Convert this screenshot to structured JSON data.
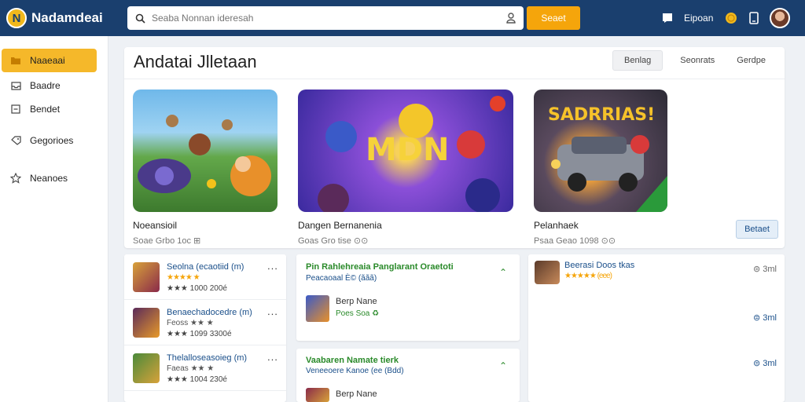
{
  "header": {
    "logo_mark": "N",
    "logo_text": "Nadamdeai",
    "search_placeholder": "Seaba Nonnan ideresah",
    "search_button": "Seaet",
    "user_label": "Eipoan"
  },
  "sidebar": {
    "items": [
      {
        "label": "Naaeaai",
        "icon": "folder-icon",
        "active": true
      },
      {
        "label": "Baadre",
        "icon": "inbox-icon",
        "active": false
      },
      {
        "label": "Bendet",
        "icon": "minus-box-icon",
        "active": false
      },
      {
        "label": "Gegorioes",
        "icon": "tag-icon",
        "active": false
      },
      {
        "label": "Neanoes",
        "icon": "star-outline-icon",
        "active": false
      }
    ]
  },
  "featured": {
    "title": "Andatai Jlletaan",
    "tabs": [
      "Benlag",
      "Seonrats",
      "Gerdpe"
    ],
    "cards": [
      {
        "name": "Noeansioil",
        "meta": "Soae Grbo 1oc ⊞"
      },
      {
        "name": "Dangen Bernanenia",
        "meta": "Goas Gro tise ⊙⊙"
      },
      {
        "name": "Pelanhaek",
        "meta": "Psaa Geao 1098 ⊙⊙"
      }
    ],
    "button": "Betaet",
    "art_text": {
      "card2": "MDN",
      "card3": "SADRRIAS!"
    }
  },
  "left_list": [
    {
      "title": "Seolna (ecaotiid (m)",
      "sub": "★★★★ ★",
      "meta": "★★★ 1000 200é"
    },
    {
      "title": "Benaechadocedre (m)",
      "sub": "Feoss ★★ ★",
      "meta": "★★★ 1099 3300é"
    },
    {
      "title": "Thelalloseasoieg (m)",
      "sub": "Faeas ★★ ★",
      "meta": "★★★ 1004 230é"
    }
  ],
  "mid_panel_1": {
    "title": "Pin Rahlehreaia Panglarant Oraetoti",
    "sub": "Peacaoaal È© (ããã)",
    "item_name": "Berp Nane",
    "item_meta": "Poes Soa ♻"
  },
  "mid_panel_2": {
    "title": "Vaabaren Namate tierk",
    "sub": "Veneeoere Kanoe (ee (Bdd)",
    "item_name": "Berp Nane"
  },
  "right_panel": {
    "title": "Beerasi Doos tkas",
    "stars": "★★★★★ (eee)",
    "times": [
      "⊜ 3ml",
      "⊜ 3ml",
      "⊜ 3ml"
    ]
  },
  "colors": {
    "topbar": "#1a3f6e",
    "accent": "#f5a50b",
    "active_side": "#f5b82a",
    "link": "#1a4f8a",
    "green": "#2a8a2a"
  }
}
